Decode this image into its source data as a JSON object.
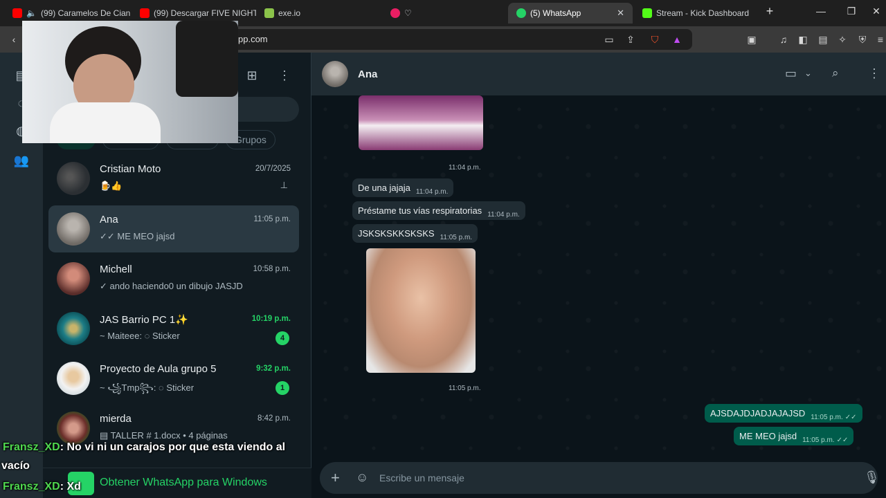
{
  "browser": {
    "tabs": [
      {
        "label": "(99) Caramelos De Cian",
        "color": "#ff0000"
      },
      {
        "label": "(99) Descargar FIVE NIGHT",
        "color": "#ff0000"
      },
      {
        "label": "exe.io",
        "color": "#8bc34a"
      },
      {
        "label": "",
        "color": "#e91e63"
      },
      {
        "label": "(5) WhatsApp",
        "color": "#25d366"
      },
      {
        "label": "Stream - Kick Dashboard",
        "color": "#53fc18"
      }
    ],
    "url_fragment": "pp.com"
  },
  "sidebar": {
    "filters": [
      "Grupos"
    ],
    "chats": [
      {
        "name": "Cristian Moto",
        "preview": "🍺👍",
        "time": "20/7/2025",
        "pinned": true
      },
      {
        "name": "Ana",
        "preview": "✓✓ ME MEO jajsd",
        "time": "11:05 p.m."
      },
      {
        "name": "Michell",
        "preview": "✓ ando haciendo0 un dibujo JASJD",
        "time": "10:58 p.m."
      },
      {
        "name": "JAS Barrio PC 1✨",
        "preview": "~ Maiteee: ◌ Sticker",
        "time": "10:19 p.m.",
        "badge": "4"
      },
      {
        "name": "Proyecto de Aula grupo 5",
        "preview": "~ ꧁Tmp꧂: ◌ Sticker",
        "time": "9:32 p.m.",
        "badge": "1"
      },
      {
        "name": "mierda",
        "preview": "▤ TALLER # 1.docx • 4 páginas",
        "time": "8:42 p.m."
      }
    ],
    "get_whatsapp": "Obtener WhatsApp para Windows"
  },
  "conversation": {
    "contact": "Ana",
    "messages": [
      {
        "text": "11:04 p.m.",
        "kind": "image-time"
      },
      {
        "text": "De una jajaja",
        "time": "11:04 p.m."
      },
      {
        "text": "Préstame tus vías respiratorias",
        "time": "11:04 p.m."
      },
      {
        "text": "JSKSKSKKSKSKS",
        "time": "11:05 p.m."
      },
      {
        "text": "11:05 p.m.",
        "kind": "image-time"
      },
      {
        "text": "AJSDAJDJADJAJAJSD",
        "time": "11:05 p.m."
      },
      {
        "text": "ME MEO jajsd",
        "time": "11:05 p.m."
      }
    ],
    "composer_placeholder": "Escribe un mensaje"
  },
  "stream_chat": [
    {
      "user": "Fransz_XD",
      "text": ": No vi ni un carajos por que esta viendo al"
    },
    {
      "user": "",
      "text": "vacío"
    },
    {
      "user": "Fransz_XD",
      "text": ": Xd"
    }
  ],
  "colors": {
    "accent": "#25d366",
    "outgoing_bubble": "#005c4b",
    "incoming_bubble": "#202c33"
  }
}
